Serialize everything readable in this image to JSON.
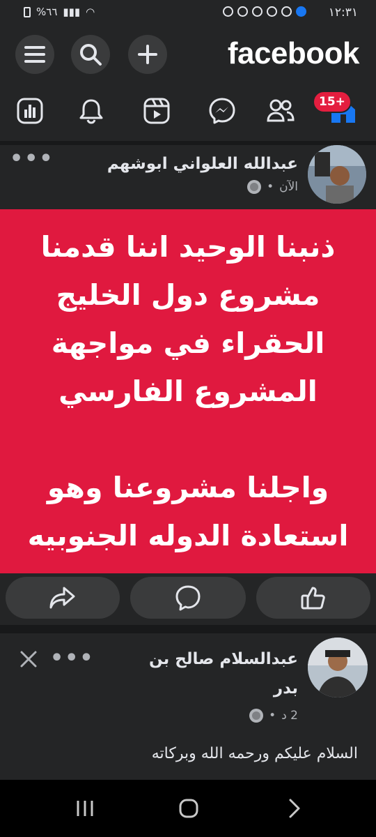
{
  "status_bar": {
    "time": "١٢:٣١",
    "battery": "%٦٦"
  },
  "header": {
    "logo": "facebook",
    "menu_icon": "menu-icon",
    "search_icon": "search-icon",
    "add_icon": "plus-icon"
  },
  "nav": {
    "items": [
      "dashboard-icon",
      "bell-icon",
      "reels-icon",
      "messenger-icon",
      "friends-icon",
      "home-icon"
    ],
    "badge": "15+"
  },
  "post1": {
    "author": "عبدالله العلواني ابوشهم",
    "time": "الآن",
    "text": "ذنبنا الوحيد اننا قدمنا\nمشروع دول الخليج\nالحقراء في مواجهة\nالمشروع الفارسي\n\nواجلنا مشروعنا وهو\nاستعادة الدوله الجنوبيه",
    "bg_color": "#e0193f"
  },
  "post2": {
    "author_line1": "عبدالسلام صالح بن",
    "author_line2": "بدر",
    "time": "2 د",
    "text": "السلام عليكم ورحمه الله وبركاته"
  },
  "colors": {
    "background": "#242526",
    "accent": "#1877f2",
    "badge": "#e41e3f"
  }
}
